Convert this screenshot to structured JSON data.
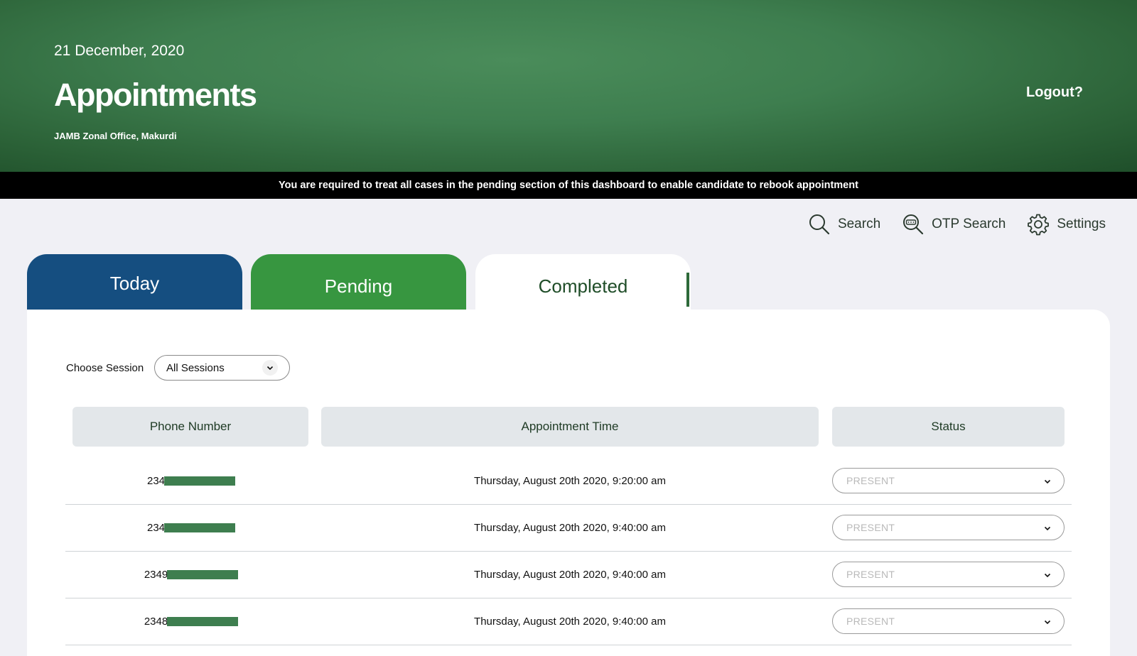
{
  "header": {
    "date": "21 December, 2020",
    "title": "Appointments",
    "office": "JAMB Zonal Office, Makurdi",
    "logout_label": "Logout?"
  },
  "notice": "You are required to treat all cases in the pending section of this dashboard to enable candidate to rebook appointment",
  "toolbar": {
    "search_label": "Search",
    "otp_search_label": "OTP Search",
    "settings_label": "Settings"
  },
  "tabs": {
    "today": "Today",
    "pending": "Pending",
    "completed": "Completed",
    "active": "completed"
  },
  "filter": {
    "session_label": "Choose Session",
    "session_value": "All Sessions"
  },
  "table": {
    "columns": [
      "Phone Number",
      "Appointment Time",
      "Status"
    ],
    "rows": [
      {
        "phone_prefix": "234",
        "time": "Thursday, August 20th 2020, 9:20:00 am",
        "status": "PRESENT"
      },
      {
        "phone_prefix": "234",
        "time": "Thursday, August 20th 2020, 9:40:00 am",
        "status": "PRESENT"
      },
      {
        "phone_prefix": "2349",
        "time": "Thursday, August 20th 2020, 9:40:00 am",
        "status": "PRESENT"
      },
      {
        "phone_prefix": "2348",
        "time": "Thursday, August 20th 2020, 9:40:00 am",
        "status": "PRESENT"
      }
    ]
  },
  "colors": {
    "hero_green": "#3e7e4f",
    "today_tab": "#154e80",
    "pending_tab": "#379640",
    "redaction": "#3e7e4f"
  }
}
